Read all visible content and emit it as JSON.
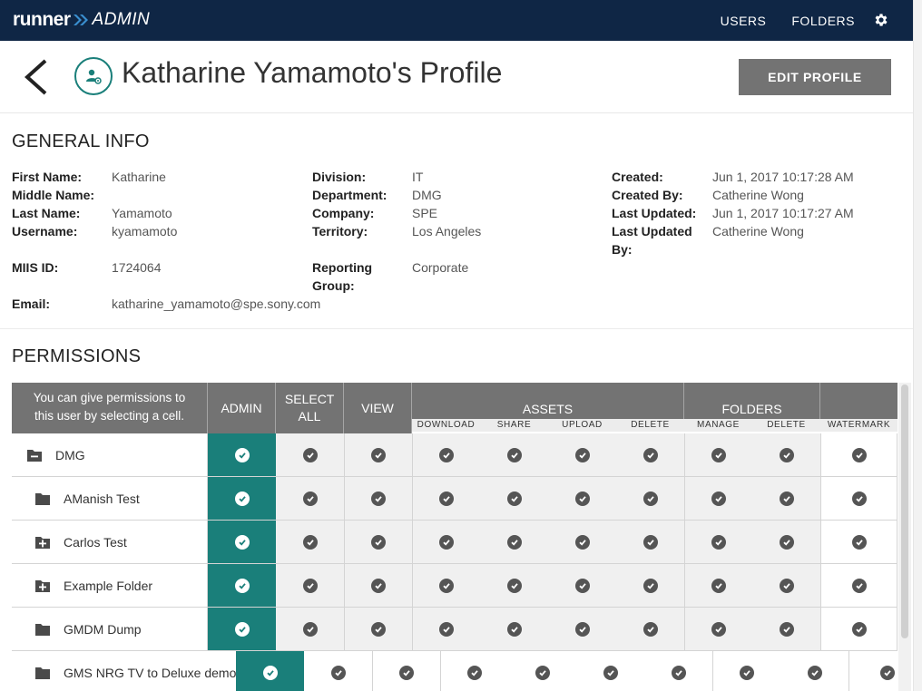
{
  "app": {
    "logo_runner": "runner",
    "logo_admin": "ADMIN"
  },
  "nav": {
    "users": "USERS",
    "folders": "FOLDERS",
    "settings_icon": "gear-icon"
  },
  "header": {
    "title": "Katharine Yamamoto's Profile",
    "edit_button": "EDIT PROFILE"
  },
  "general_info": {
    "title": "GENERAL INFO",
    "col1": [
      {
        "label": "First Name:",
        "value": "Katharine"
      },
      {
        "label": "Middle Name:",
        "value": ""
      },
      {
        "label": "Last Name:",
        "value": "Yamamoto"
      },
      {
        "label": "Username:",
        "value": "kyamamoto"
      },
      {
        "label": "MIIS ID:",
        "value": "1724064"
      },
      {
        "label": "Email:",
        "value": "katharine_yamamoto@spe.sony.com"
      }
    ],
    "col2": [
      {
        "label": "Division:",
        "value": "IT"
      },
      {
        "label": "Department:",
        "value": "DMG"
      },
      {
        "label": "Company:",
        "value": "SPE"
      },
      {
        "label": "Territory:",
        "value": "Los Angeles"
      },
      {
        "label": "Reporting",
        "label2": "Group:",
        "value": "Corporate"
      }
    ],
    "col3": [
      {
        "label": "Created:",
        "value": "Jun 1, 2017 10:17:28 AM"
      },
      {
        "label": "Created By:",
        "value": "Catherine Wong"
      },
      {
        "label": "Last Updated:",
        "value": "Jun 1, 2017 10:17:27 AM"
      },
      {
        "label": "Last Updated",
        "label2": "By:",
        "value": "Catherine Wong"
      }
    ]
  },
  "permissions": {
    "title": "PERMISSIONS",
    "hint": "You can give permissions to this user by selecting a cell.",
    "headers": {
      "admin": "ADMIN",
      "select_all": "SELECT ALL",
      "view": "VIEW",
      "assets": "ASSETS",
      "folders": "FOLDERS"
    },
    "sub_headers": [
      "DOWNLOAD",
      "SHARE",
      "UPLOAD",
      "DELETE",
      "MANAGE",
      "DELETE",
      "WATERMARK"
    ],
    "rows": [
      {
        "name": "DMG",
        "icon": "collapse-folder-icon"
      },
      {
        "name": "AManish Test",
        "icon": "folder-icon"
      },
      {
        "name": "Carlos Test",
        "icon": "expand-folder-icon"
      },
      {
        "name": "Example Folder",
        "icon": "expand-folder-icon"
      },
      {
        "name": "GMDM Dump",
        "icon": "folder-icon"
      },
      {
        "name": "GMS NRG TV to Deluxe demo",
        "icon": "folder-icon"
      }
    ]
  },
  "colors": {
    "topbar": "#0f2645",
    "accent": "#1a7f7a",
    "header_gray": "#737373"
  }
}
